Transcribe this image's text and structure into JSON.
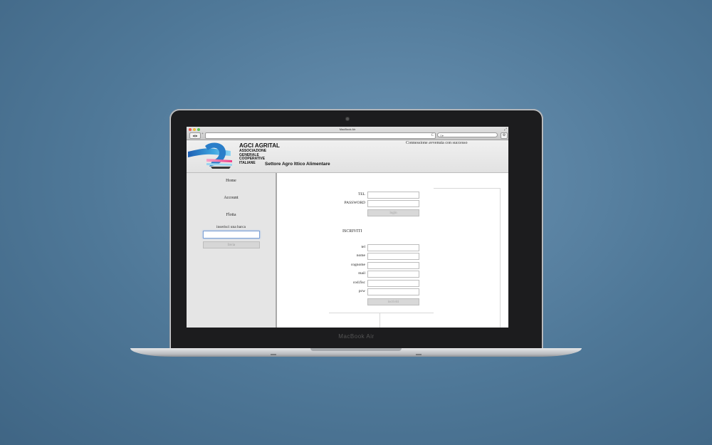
{
  "device": {
    "brand": "MacBook Air"
  },
  "browser": {
    "window_title": "MacBook Air",
    "nav_buttons": "◀ ▶",
    "new_tab": "+",
    "reload": "C",
    "search_placeholder": "Q▾",
    "settings": "⚙",
    "traffic_lights": {
      "close": "#ee5b52",
      "minimize": "#f2bd3c",
      "zoom": "#61c454"
    }
  },
  "header": {
    "org_name": "AGCI AGRITAL",
    "org_sub": [
      "ASSOCIAZIONE",
      "GENERALE",
      "COOPERATIVE",
      "ITALIANE"
    ],
    "sector": "Settore Agro Ittico Alimentare",
    "status_message": "Connessione avvenuta con successo"
  },
  "sidebar": {
    "nav": [
      {
        "label": "Home"
      },
      {
        "label": "Account"
      },
      {
        "label": "Flotta"
      }
    ],
    "boat_label": "inserisci una barca",
    "boat_input_value": "",
    "boat_submit": "Invia"
  },
  "login": {
    "tel_label": "TEL",
    "password_label": "PASSWORD",
    "tel_value": "",
    "password_value": "",
    "submit": "login"
  },
  "register": {
    "heading": "ISCRIVITI",
    "fields": [
      {
        "label": "tel",
        "value": ""
      },
      {
        "label": "nome",
        "value": ""
      },
      {
        "label": "cognome",
        "value": ""
      },
      {
        "label": "mail",
        "value": ""
      },
      {
        "label": "cod.fisc",
        "value": ""
      },
      {
        "label": "pcw",
        "value": ""
      }
    ],
    "submit": "iscriviti"
  }
}
